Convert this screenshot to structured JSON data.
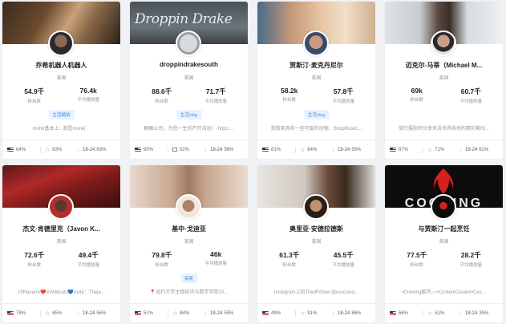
{
  "cards": [
    {
      "name": "乔希机器人机器人",
      "region": "美国",
      "fans": "54.9千",
      "fans_label": "粉丝数",
      "views": "76.4k",
      "views_label": "平均播放量",
      "tag": "生活随拍",
      "desc": "mshh基本上...我是monki゛",
      "country_pct": "64%",
      "star_pct": "83%",
      "age": "18-24",
      "age_pct": "83%"
    },
    {
      "name": "droppindrakesouth",
      "region": "美国",
      "fans": "88.6千",
      "fans_label": "粉丝数",
      "views": "71.7千",
      "views_label": "平均播放量",
      "tag": "生活vlog",
      "desc": "酮确公司，为您一生的产开活动！-https:...",
      "country_pct": "90%",
      "star_pct": "52%",
      "age": "18-24",
      "age_pct": "56%"
    },
    {
      "name": "贾斯汀·麦克丹尼尔",
      "region": "美国",
      "fans": "58.2k",
      "fans_label": "粉丝数",
      "views": "57.8千",
      "views_label": "平均播放量",
      "tag": "生活vlog",
      "desc": "我做家具和一些可爱的动物。ShopRustic...",
      "country_pct": "81%",
      "star_pct": "84%",
      "age": "18-24",
      "age_pct": "55%"
    },
    {
      "name": "迈克尔·马蒂（Michael M...",
      "region": "美国",
      "fans": "69k",
      "fans_label": "粉丝数",
      "views": "60.7千",
      "views_label": "平均播放量",
      "tag": "",
      "desc": "旅行摄影师分享来自世界各地的精彩瞬间...",
      "country_pct": "87%",
      "star_pct": "71%",
      "age": "18-24",
      "age_pct": "61%"
    },
    {
      "name": "杰文·肯德里克（Javon K...",
      "region": "美国",
      "fans": "72.6千",
      "fans_label": "粉丝数",
      "views": "49.4千",
      "views_label": "平均播放量",
      "tag": "",
      "desc": "19Navarro❤️&Wildcats💙Insta：Theja...",
      "country_pct": "76%",
      "star_pct": "85%",
      "age": "18-24",
      "age_pct": "56%"
    },
    {
      "name": "基中·戈迪亚",
      "region": "美国",
      "fans": "79.8千",
      "fans_label": "粉丝数",
      "views": "46k",
      "views_label": "平均播放量",
      "tag": "搞笑",
      "desc": "📍纽约大学主修经济与数学学院20...",
      "country_pct": "51%",
      "star_pct": "84%",
      "age": "18-24",
      "age_pct": "55%"
    },
    {
      "name": "奥里亚·安德拉德斯",
      "region": "美国",
      "fans": "61.3千",
      "fans_label": "粉丝数",
      "views": "45.5千",
      "views_label": "平均播放量",
      "tag": "",
      "desc": "Instagram上的TiredFollow @ruuccout...",
      "country_pct": "49%",
      "star_pct": "91%",
      "age": "18-24",
      "age_pct": "86%"
    },
    {
      "name": "与贾斯汀一起烹饪",
      "region": "美国",
      "fans": "77.5千",
      "fans_label": "粉丝数",
      "views": "28.2千",
      "views_label": "平均播放量",
      "tag": "",
      "desc": "•Crewing酷烹○○•ContentCreator•Cas...",
      "country_pct": "66%",
      "star_pct": "51%",
      "age": "18-24",
      "age_pct": "35%"
    }
  ],
  "icons": {
    "country": "us-flag-icon",
    "gender": "star-icon",
    "age": "age-icon"
  }
}
